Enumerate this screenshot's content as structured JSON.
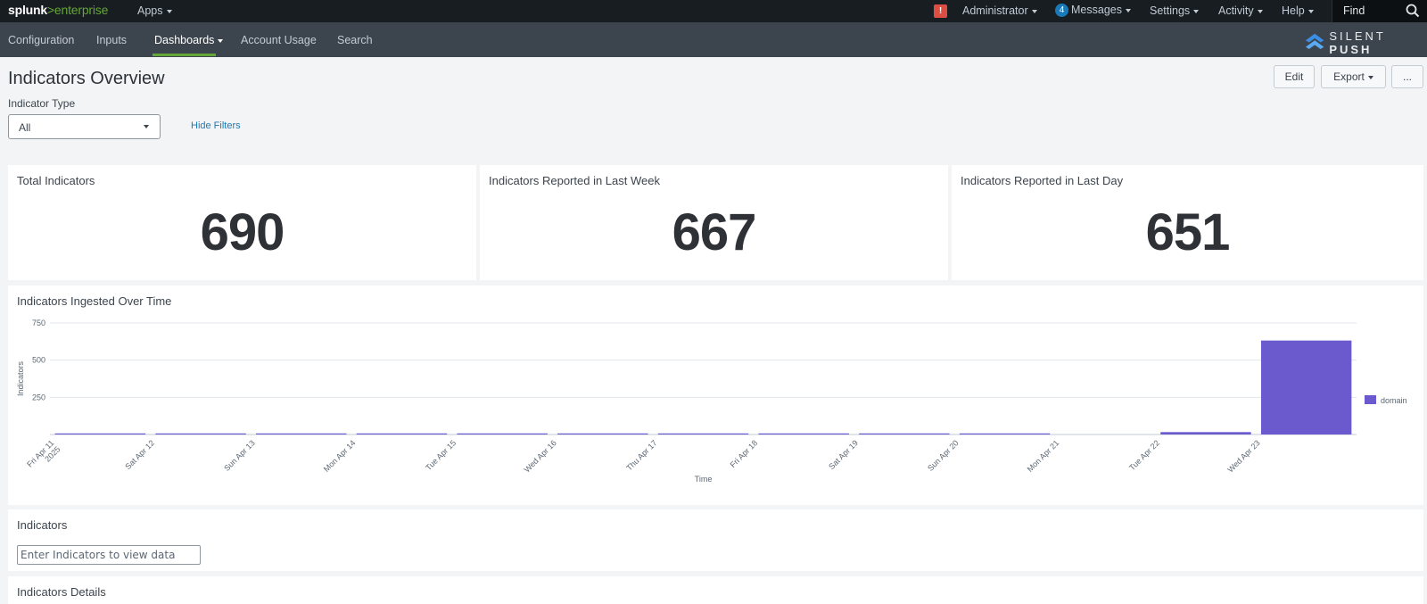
{
  "topbar": {
    "logo_part1": "splunk",
    "logo_gt": ">",
    "logo_part2": "enterprise",
    "apps": "Apps",
    "administrator": "Administrator",
    "messages_count": "4",
    "messages": "Messages",
    "settings": "Settings",
    "activity": "Activity",
    "help": "Help",
    "find": "Find"
  },
  "nav": {
    "items": [
      "Configuration",
      "Inputs",
      "Dashboards",
      "Account Usage",
      "Search"
    ],
    "active": "Dashboards",
    "brand_light": "SILENT ",
    "brand_bold": "PUSH"
  },
  "page": {
    "title": "Indicators Overview",
    "edit": "Edit",
    "export": "Export",
    "more": "..."
  },
  "filters": {
    "label": "Indicator Type",
    "selected": "All",
    "hide": "Hide Filters"
  },
  "single_values": [
    {
      "title": "Total Indicators",
      "value": "690"
    },
    {
      "title": "Indicators Reported in Last Week",
      "value": "667"
    },
    {
      "title": "Indicators Reported in Last Day",
      "value": "651"
    }
  ],
  "chart_panel": {
    "title": "Indicators Ingested Over Time"
  },
  "chart_data": {
    "type": "bar",
    "categories": [
      "Fri Apr 11 2025",
      "Sat Apr 12",
      "Sun Apr 13",
      "Mon Apr 14",
      "Tue Apr 15",
      "Wed Apr 16",
      "Thu Apr 17",
      "Fri Apr 18",
      "Sat Apr 19",
      "Sun Apr 20",
      "Mon Apr 21",
      "Tue Apr 22",
      "Wed Apr 23"
    ],
    "series": [
      {
        "name": "domain",
        "values": [
          1,
          1,
          1,
          1,
          1,
          1,
          1,
          1,
          1,
          1,
          0,
          16,
          632
        ]
      }
    ],
    "xlabel": "Time",
    "ylabel": "Indicators",
    "yticks": [
      250,
      500,
      750
    ],
    "ylim": [
      0,
      750
    ],
    "grid": true,
    "legend": "right",
    "color": "#6a5acd"
  },
  "indicators_panel": {
    "title": "Indicators",
    "placeholder": "Enter Indicators to view data"
  },
  "details_panel": {
    "title": "Indicators Details"
  }
}
